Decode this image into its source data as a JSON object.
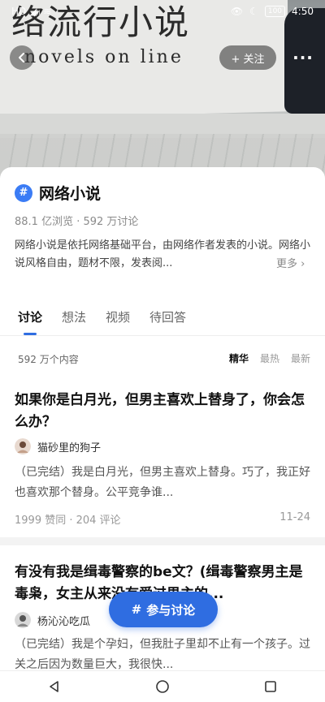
{
  "hero": {
    "sign_text_big": "络流行小说",
    "sign_text_small": "novels on line"
  },
  "status_bar": {
    "left": "HD  ◢ᵢₗ  ≋",
    "battery": "100",
    "time": "4:50"
  },
  "nav": {
    "follow_label": "+ 关注",
    "more_label": "···"
  },
  "topic": {
    "badge": "#",
    "title": "网络小说",
    "stats": "88.1 亿浏览 · 592 万讨论",
    "description": "网络小说是依托网络基础平台，由网络作者发表的小说。网络小说风格自由，题材不限，发表阅...",
    "more_label": "更多 ›"
  },
  "tabs": [
    {
      "label": "讨论",
      "active": true
    },
    {
      "label": "想法",
      "active": false
    },
    {
      "label": "视频",
      "active": false
    },
    {
      "label": "待回答",
      "active": false
    }
  ],
  "filter": {
    "count": "592 万个内容",
    "sorts": [
      {
        "label": "精华",
        "active": true
      },
      {
        "label": "最热",
        "active": false
      },
      {
        "label": "最新",
        "active": false
      }
    ]
  },
  "posts": [
    {
      "title": "如果你是白月光，但男主喜欢上替身了，你会怎么办？",
      "author": "猫砂里的狗子",
      "excerpt": "（已完结）我是白月光，但男主喜欢上替身。巧了，我正好也喜欢那个替身。公平竞争谁...",
      "meta": "1999 赞同 · 204 评论",
      "date": "11-24"
    },
    {
      "title": "有没有我是缉毒警察的be文？(缉毒警察男主是毒枭，女主从来没有爱过男主的...",
      "author": "杨沁沁吃瓜",
      "excerpt": "（已完结）我是个孕妇，但我肚子里却不止有一个孩子。过关之后因为数量巨大，我很快...",
      "meta": "",
      "date": ""
    }
  ],
  "join_button": {
    "icon": "#",
    "label": "参与讨论"
  },
  "colors": {
    "accent": "#2f6de1",
    "badge": "#3b7cf5"
  }
}
